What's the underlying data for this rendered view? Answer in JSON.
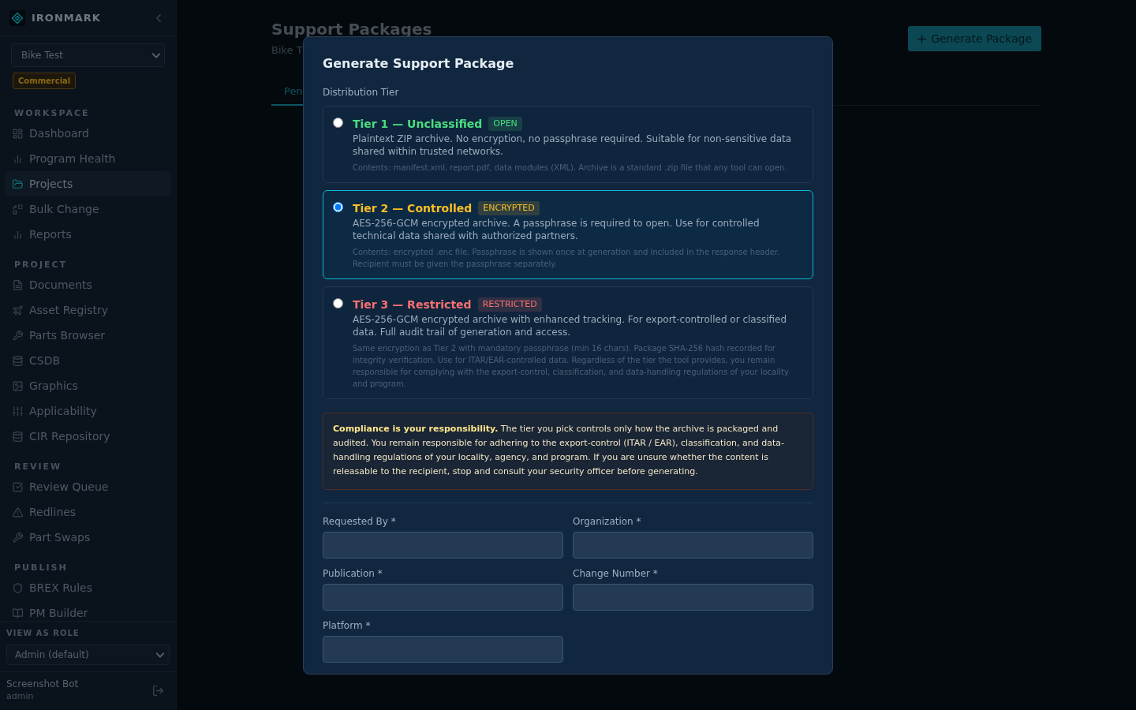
{
  "sidebar": {
    "brand": "IRONMARK",
    "project_select": {
      "value": "Bike Test"
    },
    "program_badge": "Commercial",
    "sections": [
      {
        "title": "WORKSPACE",
        "items": [
          {
            "label": "Dashboard",
            "selected": false
          },
          {
            "label": "Program Health",
            "selected": false
          },
          {
            "label": "Projects",
            "selected": true
          },
          {
            "label": "Bulk Change",
            "selected": false
          },
          {
            "label": "Reports",
            "selected": false
          }
        ]
      },
      {
        "title": "PROJECT",
        "items": [
          {
            "label": "Documents",
            "selected": false
          },
          {
            "label": "Asset Registry",
            "selected": false
          },
          {
            "label": "Parts Browser",
            "selected": false
          },
          {
            "label": "CSDB",
            "selected": false
          },
          {
            "label": "Graphics",
            "selected": false
          },
          {
            "label": "Applicability",
            "selected": false
          },
          {
            "label": "CIR Repository",
            "selected": false
          }
        ]
      },
      {
        "title": "REVIEW",
        "items": [
          {
            "label": "Review Queue",
            "selected": false
          },
          {
            "label": "Redlines",
            "selected": false
          },
          {
            "label": "Part Swaps",
            "selected": false
          }
        ]
      },
      {
        "title": "PUBLISH",
        "items": [
          {
            "label": "BREX Rules",
            "selected": false
          },
          {
            "label": "PM Builder",
            "selected": false
          }
        ]
      }
    ],
    "role_select": {
      "label": "VIEW AS ROLE",
      "value": "Admin (default)"
    },
    "user": {
      "name": "Screenshot Bot",
      "role": "admin"
    }
  },
  "page": {
    "title": "Support Packages",
    "subtitle": "Bike T",
    "tabs": [
      {
        "label": "Pen",
        "selected": true
      }
    ],
    "primary_button": {
      "label": "Generate Package"
    }
  },
  "modal": {
    "title": "Generate Support Package",
    "tier_label": "Distribution Tier",
    "tiers": [
      {
        "title": "Tier 1 — Unclassified",
        "badge": "OPEN",
        "color": "#4ade80",
        "selected": false,
        "description": "Plaintext ZIP archive. No encryption, no passphrase required. Suitable for non-sensitive data shared within trusted networks.",
        "contents": "Contents: manifest.xml, report.pdf, data modules (XML). Archive is a standard .zip file that any tool can open."
      },
      {
        "title": "Tier 2 — Controlled",
        "badge": "ENCRYPTED",
        "color": "#fbbf24",
        "selected": true,
        "description": "AES-256-GCM encrypted archive. A passphrase is required to open. Use for controlled technical data shared with authorized partners.",
        "contents": "Contents: encrypted .enc file. Passphrase is shown once at generation and included in the response header. Recipient must be given the passphrase separately."
      },
      {
        "title": "Tier 3 — Restricted",
        "badge": "RESTRICTED",
        "color": "#f87171",
        "selected": false,
        "description": "AES-256-GCM encrypted archive with enhanced tracking. For export-controlled or classified data. Full audit trail of generation and access.",
        "contents": "Same encryption as Tier 2 with mandatory passphrase (min 16 chars). Package SHA-256 hash recorded for integrity verification. Use for ITAR/EAR-controlled data. Regardless of the tier the tool provides, you remain responsible for complying with the export-control, classification, and data-handling regulations of your locality and program."
      }
    ],
    "notice": "**Compliance is your responsibility.** The tier you pick controls only how the archive is packaged and audited. You remain responsible for adhering to the export-control (ITAR / EAR), classification, and data-handling regulations of your locality, agency, and program. If you are unsure whether the content is releasable to the recipient, stop and consult your security officer before generating.",
    "fields": [
      {
        "label": "Requested By *"
      },
      {
        "label": "Organization *"
      },
      {
        "label": "Publication *"
      },
      {
        "label": "Change Number *"
      },
      {
        "label": "Platform *"
      }
    ]
  }
}
